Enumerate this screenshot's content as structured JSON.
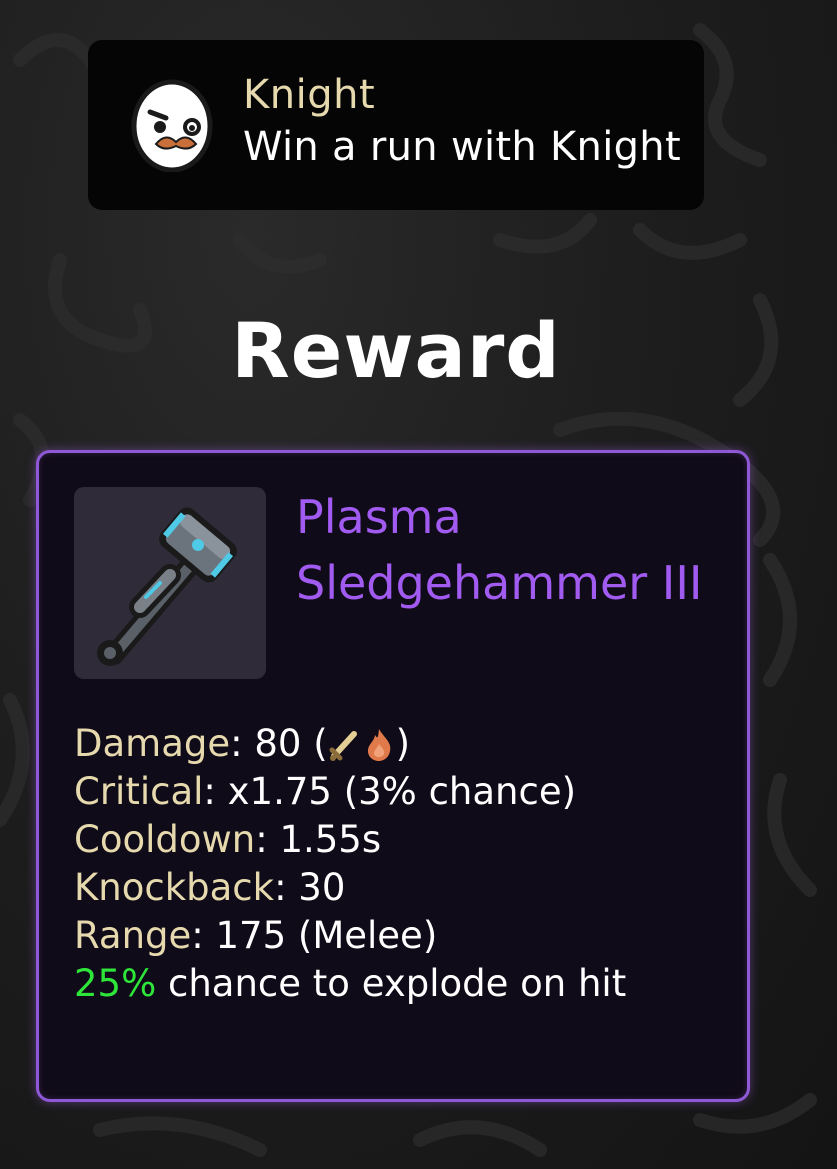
{
  "achievement": {
    "title": "Knight",
    "description": "Win a run with Knight",
    "avatar_icon": "egg-mustache-character-icon"
  },
  "reward": {
    "heading": "Reward"
  },
  "item": {
    "name": "Plasma Sledgehammer III",
    "icon": "plasma-sledgehammer-icon",
    "name_color": "#a25bf0",
    "border_color": "#8f58d6",
    "stats": {
      "damage": {
        "label": "Damage",
        "value_prefix": ": 80 (",
        "scaling_icons": [
          "sword-icon",
          "fire-icon"
        ],
        "value_suffix": ")"
      },
      "critical": {
        "label": "Critical",
        "value": ": x1.75 (3% chance)"
      },
      "cooldown": {
        "label": "Cooldown",
        "value": ": 1.55s"
      },
      "knockback": {
        "label": "Knockback",
        "value": ": 30"
      },
      "range": {
        "label": "Range",
        "value": ": 175 (Melee)"
      },
      "effect": {
        "highlight": "25%",
        "text": " chance to explode on hit",
        "highlight_color": "#2ee63a"
      }
    }
  }
}
